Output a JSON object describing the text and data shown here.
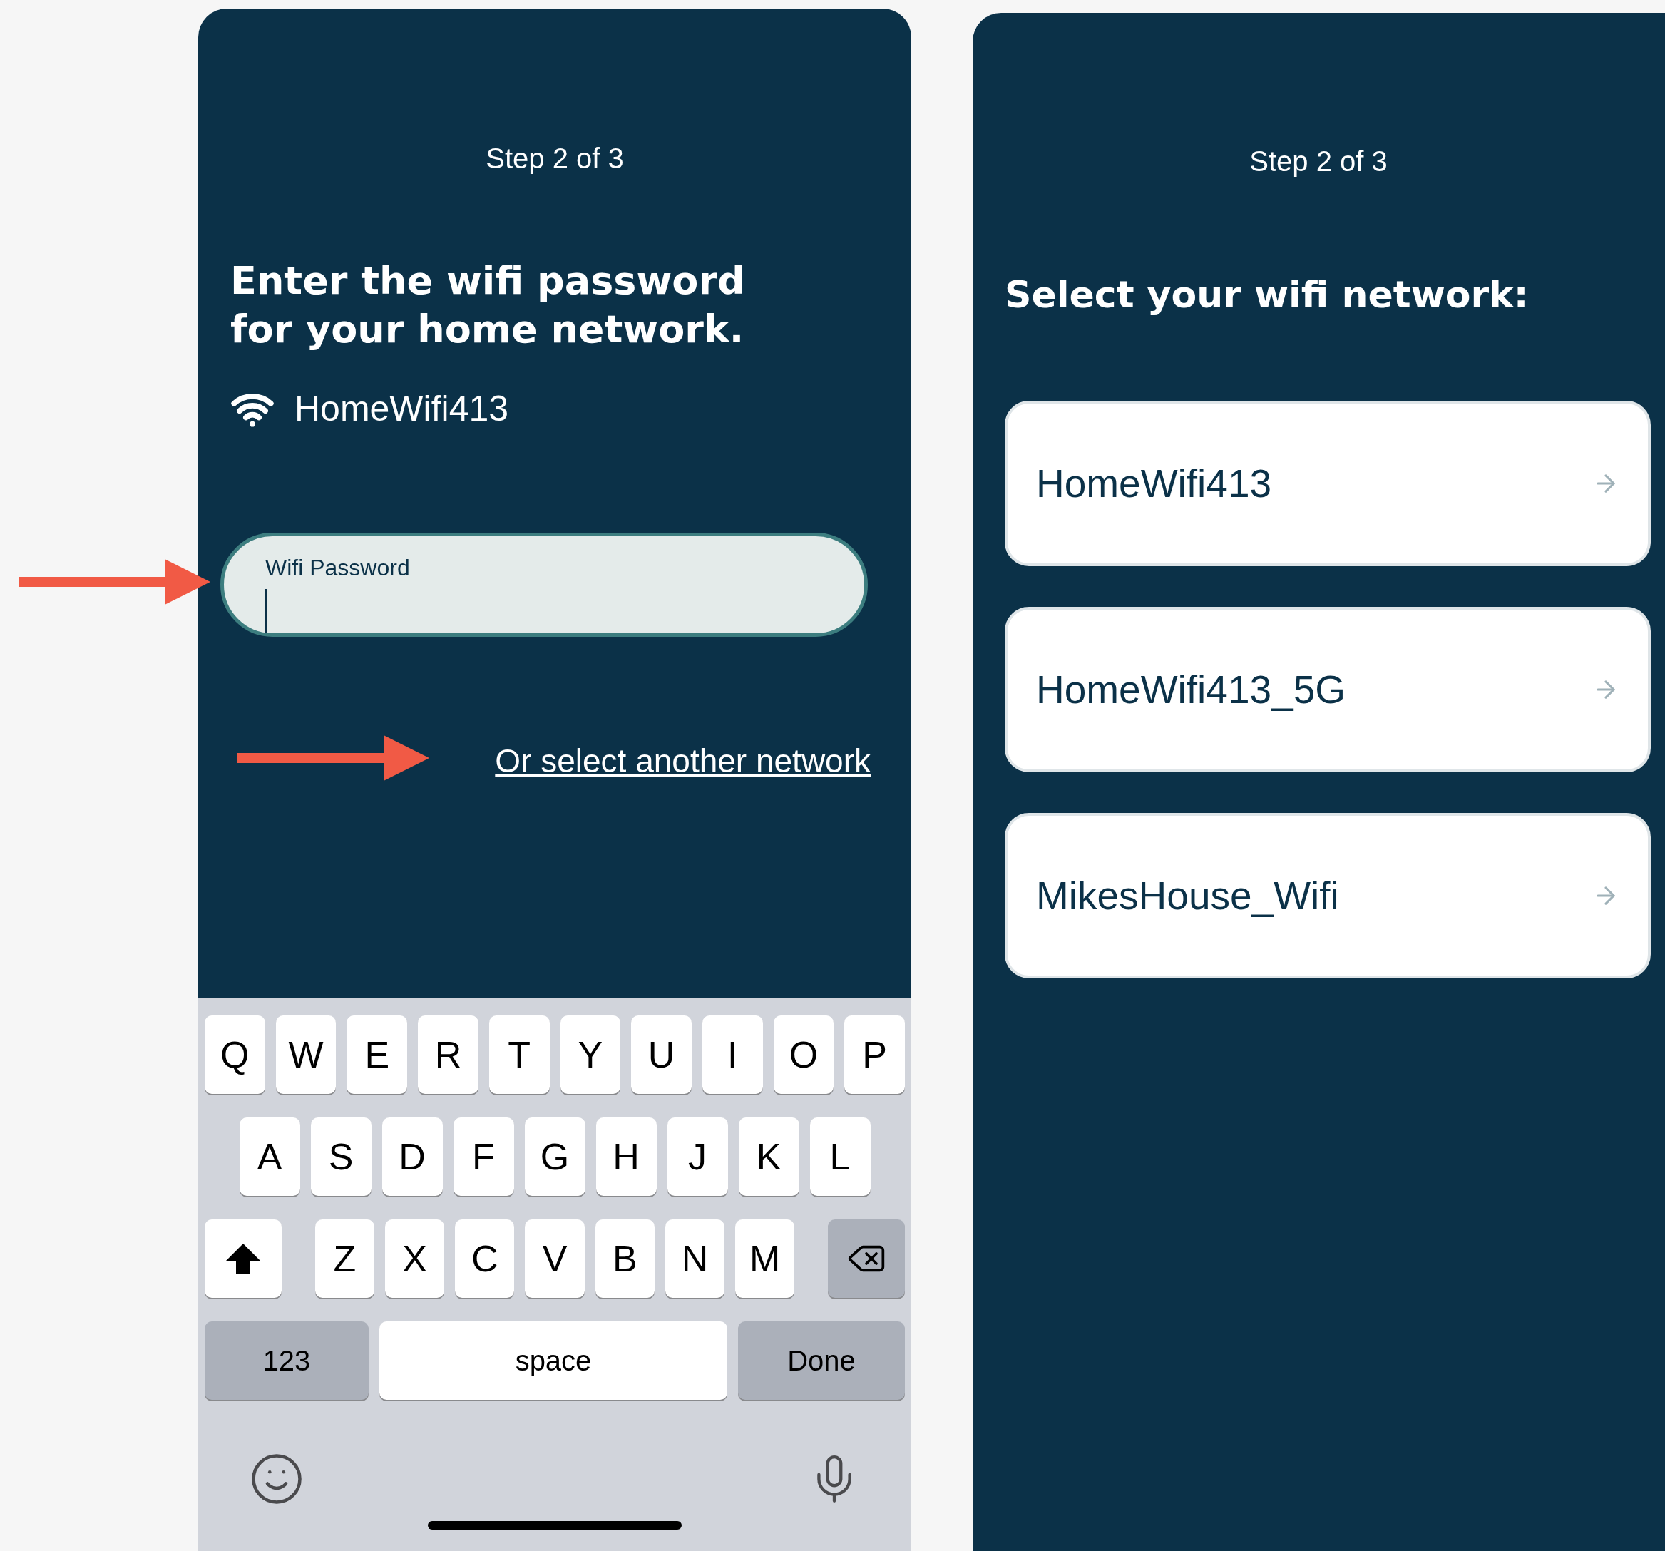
{
  "left_screen": {
    "step": "Step 2 of 3",
    "heading": "Enter the wifi password for your home network.",
    "network_name": "HomeWifi413",
    "password_field": {
      "label": "Wifi Password"
    },
    "link": "Or select another network",
    "keyboard": {
      "rows": [
        [
          {
            "kind": "letter",
            "label": "Q"
          },
          {
            "kind": "letter",
            "label": "W"
          },
          {
            "kind": "letter",
            "label": "E"
          },
          {
            "kind": "letter",
            "label": "R"
          },
          {
            "kind": "letter",
            "label": "T"
          },
          {
            "kind": "letter",
            "label": "Y"
          },
          {
            "kind": "letter",
            "label": "U"
          },
          {
            "kind": "letter",
            "label": "I"
          },
          {
            "kind": "letter",
            "label": "O"
          },
          {
            "kind": "letter",
            "label": "P"
          }
        ],
        [
          {
            "kind": "letter",
            "label": "A"
          },
          {
            "kind": "letter",
            "label": "S"
          },
          {
            "kind": "letter",
            "label": "D"
          },
          {
            "kind": "letter",
            "label": "F"
          },
          {
            "kind": "letter",
            "label": "G"
          },
          {
            "kind": "letter",
            "label": "H"
          },
          {
            "kind": "letter",
            "label": "J"
          },
          {
            "kind": "letter",
            "label": "K"
          },
          {
            "kind": "letter",
            "label": "L"
          }
        ],
        [
          {
            "kind": "shift"
          },
          {
            "kind": "letter",
            "label": "Z"
          },
          {
            "kind": "letter",
            "label": "X"
          },
          {
            "kind": "letter",
            "label": "C"
          },
          {
            "kind": "letter",
            "label": "V"
          },
          {
            "kind": "letter",
            "label": "B"
          },
          {
            "kind": "letter",
            "label": "N"
          },
          {
            "kind": "letter",
            "label": "M"
          },
          {
            "kind": "backspace"
          }
        ]
      ],
      "bottom_bar": [
        {
          "kind": "mode",
          "label": "123"
        },
        {
          "kind": "space",
          "label": "space"
        },
        {
          "kind": "action",
          "label": "Done"
        }
      ]
    }
  },
  "right_screen": {
    "step": "Step 2 of 3",
    "heading": "Select your wifi network:",
    "networks": [
      {
        "name": "HomeWifi413"
      },
      {
        "name": "HomeWifi413_5G"
      },
      {
        "name": "MikesHouse_Wifi"
      }
    ]
  }
}
